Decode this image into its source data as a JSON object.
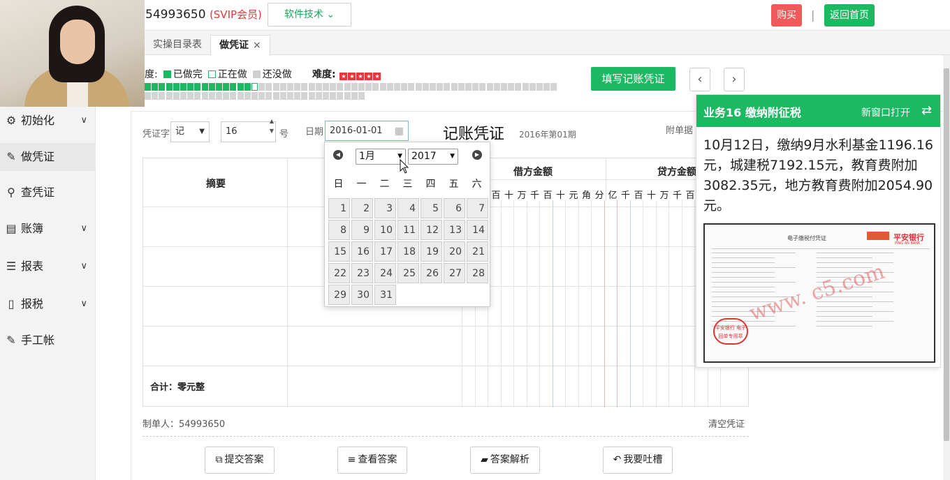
{
  "header": {
    "user_id": "54993650",
    "vip_label": "(SVIP会员)",
    "software_menu": "软件技术",
    "buy_label": "购买",
    "separator": "|",
    "home_label": "返回首页"
  },
  "tabs": [
    {
      "label": "实操目录表"
    },
    {
      "label": "做凭证",
      "close": "×"
    }
  ],
  "progress": {
    "prefix": "度:",
    "done_label": "已做完",
    "doing_label": "正在做",
    "todo_label": "还没做",
    "difficulty_label": "难度:",
    "difficulty_stars": 5,
    "done_count": 15,
    "current_index": 16,
    "total_cells": 89
  },
  "actions": {
    "fill_voucher": "填写记账凭证",
    "prev": "‹",
    "next": "›"
  },
  "sidebar": {
    "items": [
      {
        "label": "初始化",
        "icon": "gear-icon",
        "glyph": "⚙",
        "chevron": true
      },
      {
        "label": "做凭证",
        "icon": "pencil-icon",
        "glyph": "✎",
        "chevron": false,
        "active": true
      },
      {
        "label": "查凭证",
        "icon": "search-icon",
        "glyph": "⚲",
        "chevron": false
      },
      {
        "label": "账簿",
        "icon": "book-icon",
        "glyph": "▤",
        "chevron": true
      },
      {
        "label": "报表",
        "icon": "list-icon",
        "glyph": "☰",
        "chevron": true
      },
      {
        "label": "报税",
        "icon": "file-icon",
        "glyph": "▯",
        "chevron": true
      },
      {
        "label": "手工帐",
        "icon": "pencil-icon",
        "glyph": "✎",
        "chevron": false
      }
    ]
  },
  "voucher": {
    "word_label": "凭证字",
    "word_value": "记",
    "number_value": "16",
    "number_suffix": "号",
    "date_label": "日期",
    "date_value": "2016-01-01",
    "title": "记账凭证",
    "period": "2016年第01期",
    "attachment_label": "附单据",
    "summary_header": "摘要",
    "debit_header": "借方金额",
    "credit_header": "贷方金额",
    "debit_digits": [
      "百",
      "十",
      "万",
      "千",
      "百",
      "十",
      "元",
      "角",
      "分"
    ],
    "credit_digits": [
      "亿",
      "千",
      "百",
      "十",
      "万",
      "千",
      "百"
    ],
    "total_label": "合计：零元整",
    "maker_label": "制单人：54993650",
    "clear_label": "清空凭证"
  },
  "datepicker": {
    "month": "1月",
    "year": "2017",
    "weekdays": [
      "日",
      "一",
      "二",
      "三",
      "四",
      "五",
      "六"
    ],
    "days": [
      1,
      2,
      3,
      4,
      5,
      6,
      7,
      8,
      9,
      10,
      11,
      12,
      13,
      14,
      15,
      16,
      17,
      18,
      19,
      20,
      21,
      22,
      23,
      24,
      25,
      26,
      27,
      28,
      29,
      30,
      31
    ]
  },
  "bottom_buttons": [
    {
      "label": "提交答案",
      "icon": "external-link-icon",
      "glyph": "⧉"
    },
    {
      "label": "查看答案",
      "icon": "database-icon",
      "glyph": "≡"
    },
    {
      "label": "答案解析",
      "icon": "folder-icon",
      "glyph": "▰"
    },
    {
      "label": "我要吐槽",
      "icon": "reply-icon",
      "glyph": "↶"
    }
  ],
  "panel": {
    "title": "业务16 缴纳附征税",
    "open_new_window": "新窗口打开",
    "swap_glyph": "⇄",
    "description": "10月12日，缴纳9月水利基金1196.16元，城建税7192.15元，教育费附加3082.35元，地方教育费附加2054.90元。",
    "receipt": {
      "title": "电子缴税付凭证",
      "bank": "平安银行",
      "bank_en": "PING AN BANK",
      "stamp": "平安银行 电子回单专用章",
      "watermark": "www.  c5.com"
    }
  },
  "colors": {
    "brand_green": "#1cb862",
    "buy_red": "#f05a5a",
    "vip_red": "#e23a3a"
  }
}
